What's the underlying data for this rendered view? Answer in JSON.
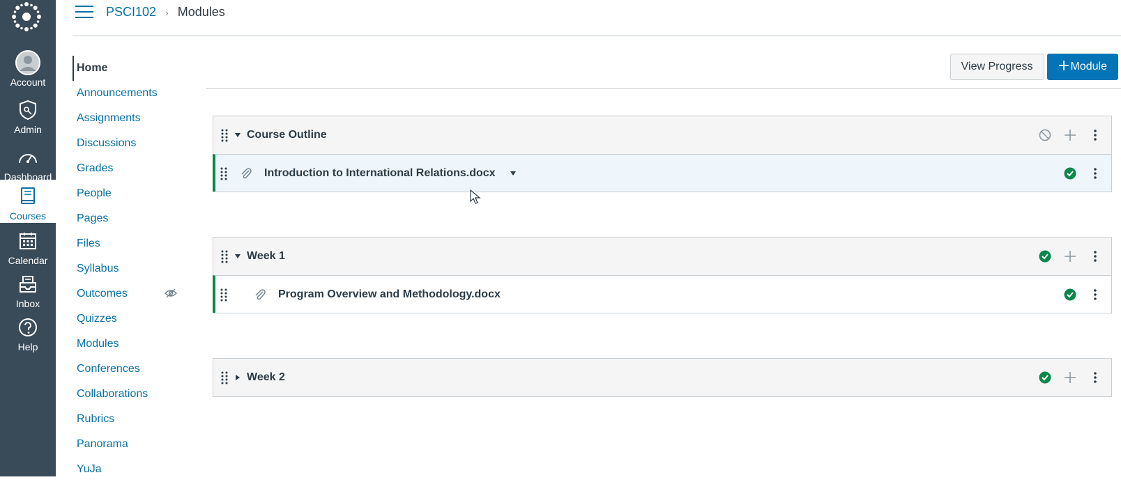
{
  "global_nav": {
    "items": [
      {
        "label": "Account",
        "icon": "account-avatar-icon"
      },
      {
        "label": "Admin",
        "icon": "admin-shield-icon"
      },
      {
        "label": "Dashboard",
        "icon": "dashboard-gauge-icon"
      },
      {
        "label": "Courses",
        "icon": "courses-book-icon",
        "active": true
      },
      {
        "label": "Calendar",
        "icon": "calendar-icon"
      },
      {
        "label": "Inbox",
        "icon": "inbox-icon"
      },
      {
        "label": "Help",
        "icon": "help-icon"
      }
    ]
  },
  "breadcrumb": {
    "course": "PSCI102",
    "separator": "›",
    "current": "Modules"
  },
  "course_nav": {
    "items": [
      {
        "label": "Home",
        "active": true
      },
      {
        "label": "Announcements"
      },
      {
        "label": "Assignments"
      },
      {
        "label": "Discussions"
      },
      {
        "label": "Grades"
      },
      {
        "label": "People"
      },
      {
        "label": "Pages"
      },
      {
        "label": "Files"
      },
      {
        "label": "Syllabus"
      },
      {
        "label": "Outcomes",
        "hidden": true
      },
      {
        "label": "Quizzes"
      },
      {
        "label": "Modules"
      },
      {
        "label": "Conferences"
      },
      {
        "label": "Collaborations"
      },
      {
        "label": "Rubrics"
      },
      {
        "label": "Panorama"
      },
      {
        "label": "YuJa"
      }
    ]
  },
  "toolbar": {
    "view_progress_label": "View Progress",
    "add_module_label": "Module"
  },
  "modules": [
    {
      "title": "Course Outline",
      "status": "unpublished",
      "expanded": true,
      "items": [
        {
          "title": "Introduction to International Relations.docx",
          "status": "published"
        }
      ]
    },
    {
      "title": "Week 1",
      "status": "published",
      "expanded": true,
      "items": [
        {
          "title": "Program Overview and Methodology.docx",
          "status": "published"
        }
      ]
    },
    {
      "title": "Week 2",
      "status": "published",
      "expanded": false,
      "items": []
    }
  ],
  "colors": {
    "nav_bg": "#394b58",
    "link": "#0770a3",
    "primary": "#0374b5",
    "success": "#0b874b"
  }
}
